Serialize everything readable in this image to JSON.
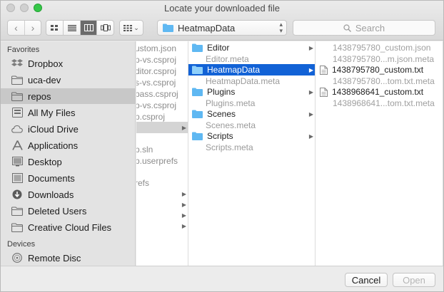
{
  "window": {
    "title": "Locate your downloaded file",
    "traffic_light_colors": [
      "#d0d0d0",
      "#d0d0d0",
      "#35c748"
    ]
  },
  "toolbar": {
    "back_icon": "chevron-left-icon",
    "forward_icon": "chevron-right-icon",
    "view_modes": [
      "icon-view",
      "list-view",
      "column-view",
      "cover-flow-view"
    ],
    "active_view": "column-view",
    "arrange_icon": "arrange-grid-icon",
    "path_popup": {
      "label": "HeatmapData",
      "icon": "folder-icon"
    },
    "search": {
      "placeholder": "Search",
      "icon": "search-icon"
    }
  },
  "sidebar": {
    "favorites_heading": "Favorites",
    "devices_heading": "Devices",
    "favorites": [
      {
        "label": "Dropbox",
        "icon": "dropbox-icon"
      },
      {
        "label": "uca-dev",
        "icon": "folder-icon"
      },
      {
        "label": "repos",
        "icon": "folder-icon",
        "selected": true
      },
      {
        "label": "All My Files",
        "icon": "all-files-icon"
      },
      {
        "label": "iCloud Drive",
        "icon": "cloud-icon"
      },
      {
        "label": "Applications",
        "icon": "applications-icon"
      },
      {
        "label": "Desktop",
        "icon": "desktop-icon"
      },
      {
        "label": "Documents",
        "icon": "documents-icon"
      },
      {
        "label": "Downloads",
        "icon": "downloads-icon"
      },
      {
        "label": "Deleted Users",
        "icon": "folder-icon"
      },
      {
        "label": "Creative Cloud Files",
        "icon": "folder-icon"
      }
    ],
    "devices": [
      {
        "label": "Remote Disc",
        "icon": "disc-icon"
      }
    ]
  },
  "columns": {
    "col1": [
      {
        "label": "ustom.json"
      },
      {
        "label": "p-vs.csproj"
      },
      {
        "label": "ditor.csproj"
      },
      {
        "label": "s-vs.csproj"
      },
      {
        "label": "pass.csproj"
      },
      {
        "label": "p-vs.csproj"
      },
      {
        "label": "p.csproj"
      },
      {
        "label": "",
        "selected": true,
        "chevron": true
      },
      {
        "label": ""
      },
      {
        "label": "p.sln"
      },
      {
        "label": "p.userprefs"
      },
      {
        "label": ""
      },
      {
        "label": "refs"
      },
      {
        "label": "",
        "chevron": true
      },
      {
        "label": "",
        "chevron": true
      },
      {
        "label": "",
        "chevron": true
      },
      {
        "label": "",
        "chevron": true
      }
    ],
    "col2": [
      {
        "label": "Editor",
        "type": "folder",
        "chevron": true
      },
      {
        "label": "Editor.meta",
        "type": "meta"
      },
      {
        "label": "HeatmapData",
        "type": "folder",
        "chevron": true,
        "selected": true
      },
      {
        "label": "HeatmapData.meta",
        "type": "meta"
      },
      {
        "label": "Plugins",
        "type": "folder",
        "chevron": true
      },
      {
        "label": "Plugins.meta",
        "type": "meta"
      },
      {
        "label": "Scenes",
        "type": "folder",
        "chevron": true
      },
      {
        "label": "Scenes.meta",
        "type": "meta"
      },
      {
        "label": "Scripts",
        "type": "folder",
        "chevron": true
      },
      {
        "label": "Scripts.meta",
        "type": "meta"
      }
    ],
    "col3": [
      {
        "label": "1438795780_custom.json",
        "type": "meta"
      },
      {
        "label": "1438795780...m.json.meta",
        "type": "meta"
      },
      {
        "label": "1438795780_custom.txt",
        "type": "doc"
      },
      {
        "label": "1438795780...tom.txt.meta",
        "type": "meta"
      },
      {
        "label": "1438968641_custom.txt",
        "type": "doc"
      },
      {
        "label": "1438968641...tom.txt.meta",
        "type": "meta"
      }
    ]
  },
  "footer": {
    "cancel_label": "Cancel",
    "open_label": "Open"
  },
  "colors": {
    "selection_blue": "#1262d6",
    "folder_blue": "#5fb8f2"
  }
}
